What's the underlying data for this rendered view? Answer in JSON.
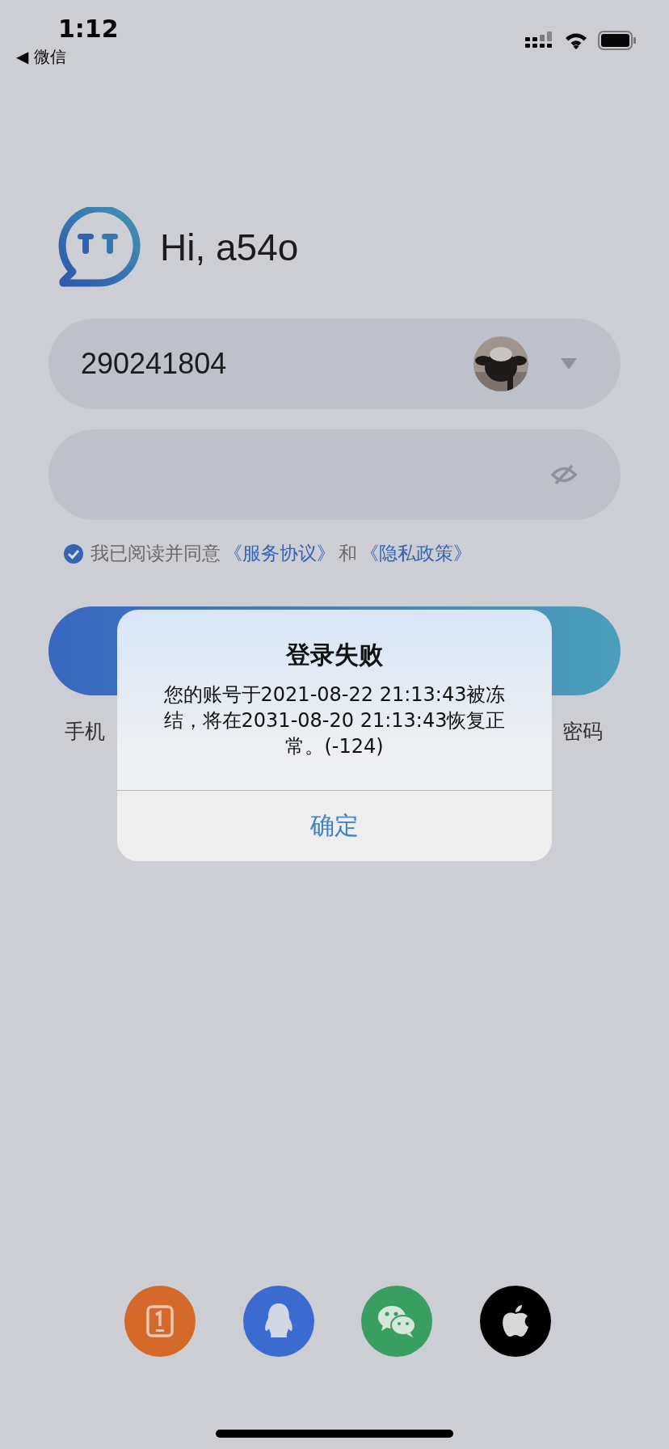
{
  "status_bar": {
    "time": "1:12",
    "back_label": "◀ 微信"
  },
  "greeting": "Hi, a54o",
  "account_field": {
    "value": "290241804"
  },
  "agreement": {
    "checked": true,
    "text": "我已阅读并同意",
    "links": [
      "《服务协议》",
      "《隐私政策》"
    ],
    "joiner": "和"
  },
  "below_links": [
    "手机",
    "密码"
  ],
  "dialog": {
    "title": "登录失败",
    "message": "您的账号于2021-08-22 21:13:43被冻结，将在2031-08-20 21:13:43恢复正常。(-124)",
    "button": "确定"
  },
  "login_options": [
    {
      "kind": "phone",
      "color": "#d4692a"
    },
    {
      "kind": "qq",
      "color": "#3b6bd0"
    },
    {
      "kind": "wechat",
      "color": "#3a9e63"
    },
    {
      "kind": "apple",
      "color": "#000000"
    }
  ]
}
